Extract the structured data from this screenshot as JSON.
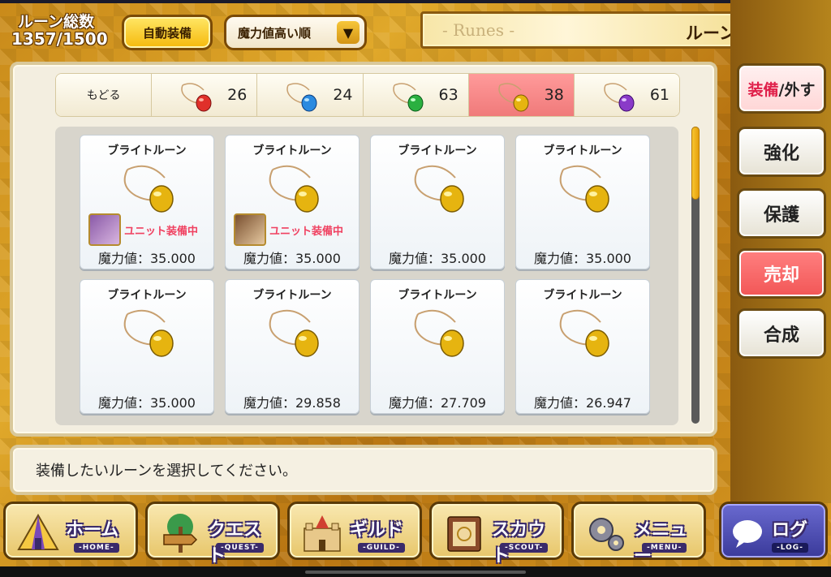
{
  "header": {
    "rune_count_label": "ルーン総数",
    "rune_count_value": "1357/1500",
    "auto_equip_label": "自動装備",
    "sort_selected": "魔力値高い順",
    "title_en": "- Runes -",
    "title_jp": "ルーン一覧",
    "help_label": "?"
  },
  "filter_tabs": [
    {
      "label": "もどる"
    },
    {
      "count": "26",
      "gem_color": "#e0302a"
    },
    {
      "count": "24",
      "gem_color": "#2a8ae0"
    },
    {
      "count": "63",
      "gem_color": "#2ab040"
    },
    {
      "count": "38",
      "gem_color": "#e6b410",
      "active": true
    },
    {
      "count": "61",
      "gem_color": "#8a3ac8"
    }
  ],
  "cards": [
    {
      "name": "ブライトルーン",
      "power": "魔力値：35.000",
      "equipped": "ユニット装備中"
    },
    {
      "name": "ブライトルーン",
      "power": "魔力値：35.000",
      "equipped": "ユニット装備中"
    },
    {
      "name": "ブライトルーン",
      "power": "魔力値：35.000"
    },
    {
      "name": "ブライトルーン",
      "power": "魔力値：35.000"
    },
    {
      "name": "ブライトルーン",
      "power": "魔力値：35.000"
    },
    {
      "name": "ブライトルーン",
      "power": "魔力値：29.858"
    },
    {
      "name": "ブライトルーン",
      "power": "魔力値：27.709"
    },
    {
      "name": "ブライトルーン",
      "power": "魔力値：26.947"
    }
  ],
  "side_buttons": {
    "equip_a": "装備",
    "equip_b": "/外す",
    "enhance": "強化",
    "protect": "保護",
    "sell": "売却",
    "combine": "合成"
  },
  "message": "装備したいルーンを選択してください。",
  "bottom_nav": [
    {
      "label": "ホーム",
      "sub": "-HOME-",
      "icon": "home-tent-icon"
    },
    {
      "label": "クエスト",
      "sub": "-QUEST-",
      "icon": "quest-signpost-icon"
    },
    {
      "label": "ギルド",
      "sub": "-GUILD-",
      "icon": "guild-castle-icon"
    },
    {
      "label": "スカウト",
      "sub": "-SCOUT-",
      "icon": "scout-book-icon"
    },
    {
      "label": "メニュー",
      "sub": "-MENU-",
      "icon": "menu-gear-icon"
    },
    {
      "label": "ログ",
      "sub": "-LOG-",
      "icon": "log-chat-icon"
    }
  ]
}
